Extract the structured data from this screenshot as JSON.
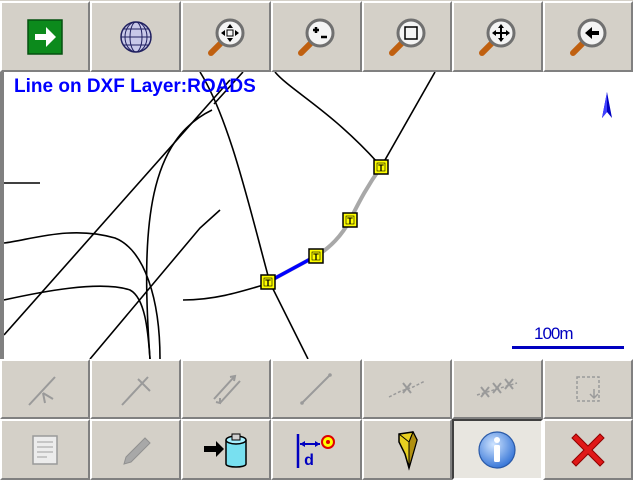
{
  "top_toolbar": {
    "buttons": [
      {
        "name": "exit-button",
        "icon": "green-arrow-right-icon"
      },
      {
        "name": "globe-button",
        "icon": "globe-icon"
      },
      {
        "name": "zoom-extents-button",
        "icon": "zoom-extents-icon"
      },
      {
        "name": "zoom-in-out-button",
        "icon": "zoom-in-out-icon"
      },
      {
        "name": "zoom-window-button",
        "icon": "zoom-window-icon"
      },
      {
        "name": "pan-button",
        "icon": "pan-icon"
      },
      {
        "name": "zoom-previous-button",
        "icon": "zoom-previous-icon"
      }
    ]
  },
  "map": {
    "title": "Line on DXF Layer:ROADS",
    "scale_label": "100m",
    "vertex_marker": "T",
    "colors": {
      "title": "#0000ff",
      "selected_segment": "#0000ff",
      "line": "#a8a8a8",
      "vertex_fill": "#ffff00"
    }
  },
  "bottom_toolbar": {
    "row1": [
      {
        "name": "go-to-start-button",
        "icon": "line-arrow-start-icon",
        "enabled": false
      },
      {
        "name": "go-to-end-button",
        "icon": "line-arrow-end-icon",
        "enabled": false
      },
      {
        "name": "reverse-direction-button",
        "icon": "double-arrow-icon",
        "enabled": false
      },
      {
        "name": "draw-line-button",
        "icon": "line-segment-icon",
        "enabled": false
      },
      {
        "name": "delete-vertex-button",
        "icon": "delete-vertex-icon",
        "enabled": false
      },
      {
        "name": "delete-vertices-button",
        "icon": "delete-vertices-icon",
        "enabled": false
      },
      {
        "name": "corner-select-button",
        "icon": "corner-select-icon",
        "enabled": false
      }
    ],
    "row2": [
      {
        "name": "attributes-button",
        "icon": "form-icon",
        "enabled": false
      },
      {
        "name": "edit-button",
        "icon": "pencil-icon",
        "enabled": false
      },
      {
        "name": "store-button",
        "icon": "database-arrow-icon",
        "enabled": true
      },
      {
        "name": "offset-button",
        "icon": "offset-distance-icon",
        "enabled": true
      },
      {
        "name": "stakeout-button",
        "icon": "stake-icon",
        "enabled": true
      },
      {
        "name": "info-button",
        "icon": "info-icon",
        "enabled": true,
        "pressed": true
      },
      {
        "name": "close-button",
        "icon": "red-x-icon",
        "enabled": true
      }
    ]
  }
}
